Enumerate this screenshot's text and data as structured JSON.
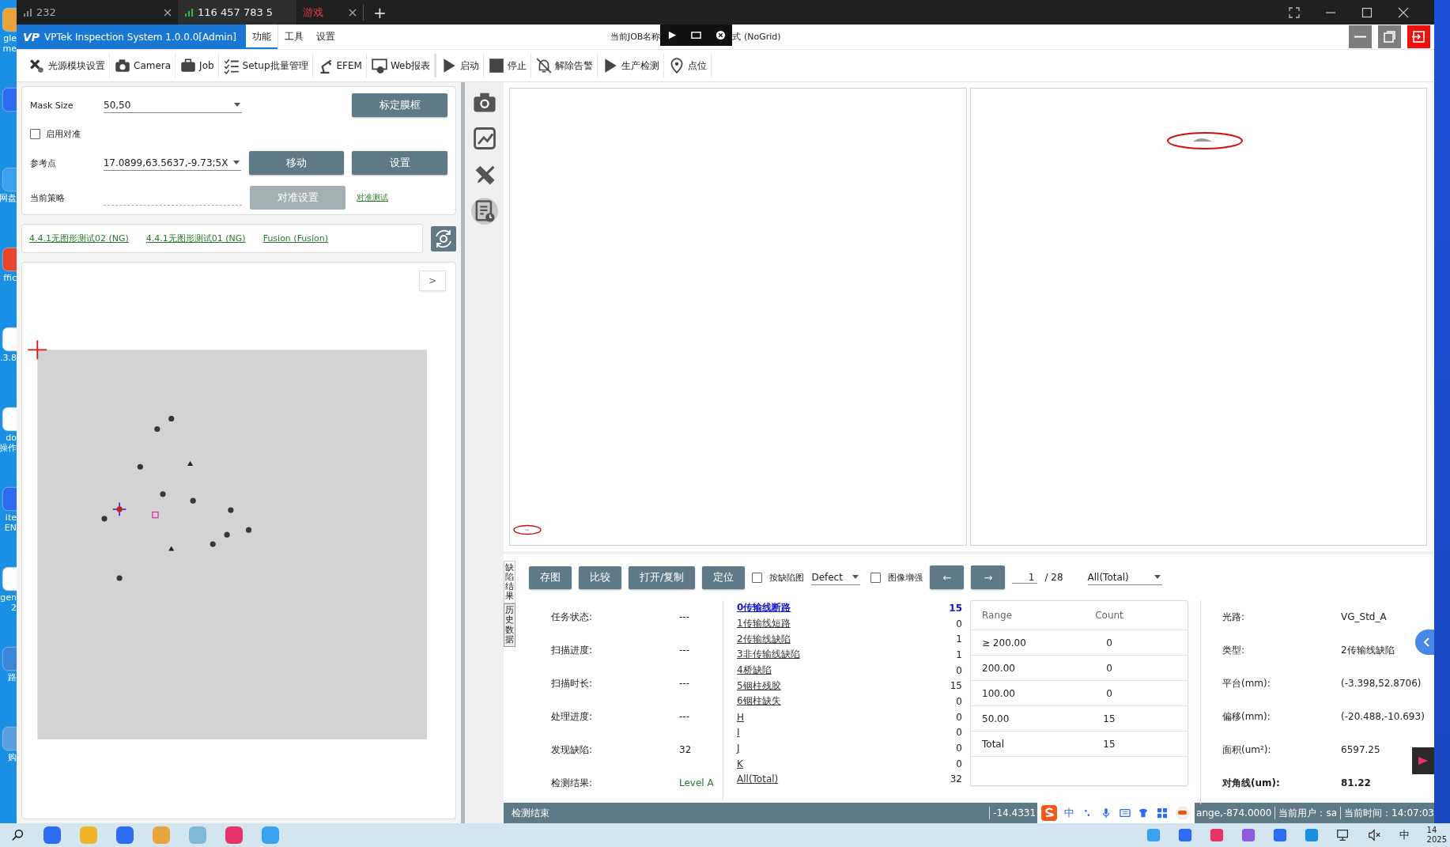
{
  "desktop": {
    "items": [
      {
        "kind": "labeled",
        "lines": [
          "gle",
          "me"
        ]
      },
      {
        "kind": "icon"
      },
      {
        "kind": "labeled",
        "lines": [
          "网盘"
        ]
      },
      {
        "kind": "labeled",
        "lines": [
          "ffic"
        ]
      },
      {
        "kind": "labeled",
        "lines": [
          ".3.8"
        ]
      },
      {
        "kind": "labeled",
        "lines": [
          "do",
          "操作"
        ]
      },
      {
        "kind": "labeled",
        "lines": [
          "ite",
          "EN"
        ]
      },
      {
        "kind": "labeled",
        "lines": [
          "gen",
          "2"
        ]
      },
      {
        "kind": "labeled",
        "lines": [
          "路"
        ]
      },
      {
        "kind": "labeled",
        "lines": [
          "购"
        ]
      }
    ]
  },
  "browser": {
    "tabs": [
      {
        "label": "232",
        "kind": "signal",
        "selected": false
      },
      {
        "label": "116 457 783 5",
        "kind": "signal",
        "selected": true
      },
      {
        "label": "游戏",
        "kind": "game",
        "selected": false
      }
    ],
    "new_tab": "+"
  },
  "app": {
    "logo": "VP",
    "title": "VPTek Inspection System 1.0.0.0[Admin]",
    "menu": [
      {
        "label": "功能",
        "selected": true
      },
      {
        "label": "工具",
        "selected": false
      },
      {
        "label": "设置",
        "selected": false
      }
    ],
    "job_title_before": "当前JOB名称",
    "job_title_after": "式 (NoGrid)"
  },
  "toolbar": [
    "光源模块设置",
    "Camera",
    "Job",
    "Setup批量管理",
    "EFEM",
    "Web报表",
    "启动",
    "停止",
    "解除告警",
    "生产检测",
    "点位"
  ],
  "setup": {
    "mask_size": {
      "label": "Mask Size",
      "value": "50,50"
    },
    "calibrate_button": "标定膜框",
    "align": {
      "label": "启用对准",
      "checked": false
    },
    "reference": {
      "label": "参考点",
      "value": "17.0899,63.5637,-9.73;5X"
    },
    "move_button": "移动",
    "set_button": "设置",
    "strategy": {
      "label": "当前策略"
    },
    "align_settings": {
      "label": "对准设置",
      "disabled": true
    },
    "align_test_link": "对准测试"
  },
  "recipes": [
    "4.4.1无图形测试02 (NG)",
    "4.4.1无图形测试01 (NG)",
    "Fusion (Fusion)"
  ],
  "map": {
    "expand_button": ">"
  },
  "side_tools": [
    {
      "selected": false
    },
    {
      "selected": false
    },
    {
      "selected": false
    },
    {
      "selected": true
    }
  ],
  "results": {
    "vtabs": [
      {
        "label": "缺陷结果",
        "selected": true
      },
      {
        "label": "历史数据",
        "selected": false
      }
    ],
    "buttons": [
      "存图",
      "比较",
      "打开/复制",
      "定位"
    ],
    "by_defect": {
      "label": "按缺陷图",
      "checked": false
    },
    "defect_select": "Defect",
    "enhance": {
      "label": "图像增强",
      "checked": false
    },
    "prev": "←",
    "next": "→",
    "page": "1",
    "total_pages": "/ 28",
    "filter": "All(Total)",
    "status": [
      {
        "label": "任务状态:",
        "value": "---",
        "kind": "plain"
      },
      {
        "label": "扫描进度:",
        "value": "---",
        "kind": "plain"
      },
      {
        "label": "扫描时长:",
        "value": "---",
        "kind": "plain"
      },
      {
        "label": "处理进度:",
        "value": "---",
        "kind": "plain"
      },
      {
        "label": "发现缺陷:",
        "value": "32",
        "kind": "plain"
      },
      {
        "label": "检测结果:",
        "value": "Level A",
        "kind": "result"
      }
    ],
    "defects": [
      {
        "name": "0传输线断路",
        "count": "15",
        "selected": true
      },
      {
        "name": "1传输线短路",
        "count": "0",
        "selected": false
      },
      {
        "name": "2传输线缺陷",
        "count": "1",
        "selected": false
      },
      {
        "name": "3非传输线缺陷",
        "count": "1",
        "selected": false
      },
      {
        "name": "4桥缺陷",
        "count": "0",
        "selected": false
      },
      {
        "name": "5铟柱残胶",
        "count": "15",
        "selected": false
      },
      {
        "name": "6铟柱缺失",
        "count": "0",
        "selected": false
      },
      {
        "name": "H",
        "count": "0",
        "selected": false
      },
      {
        "name": "I",
        "count": "0",
        "selected": false
      },
      {
        "name": "J",
        "count": "0",
        "selected": false
      },
      {
        "name": "K",
        "count": "0",
        "selected": false
      },
      {
        "name": "All(Total)",
        "count": "32",
        "selected": false
      }
    ],
    "ranges": {
      "columns": [
        "Range",
        "Count"
      ],
      "rows": [
        [
          "≥ 200.00",
          "0"
        ],
        [
          "200.00",
          "0"
        ],
        [
          "100.00",
          "0"
        ],
        [
          "50.00",
          "15"
        ],
        [
          "Total",
          "15"
        ]
      ]
    },
    "details": [
      {
        "label": "光路:",
        "value": "VG_Std_A",
        "emphasis": false
      },
      {
        "label": "类型:",
        "value": "2传输线缺陷",
        "emphasis": false
      },
      {
        "label": "平台(mm):",
        "value": "(-3.398,52.8706)",
        "emphasis": false
      },
      {
        "label": "偏移(mm):",
        "value": "(-20.488,-10.693)",
        "emphasis": false
      },
      {
        "label": "面积(um²):",
        "value": "6597.25",
        "emphasis": false
      },
      {
        "label": "对角线(um):",
        "value": "81.22",
        "emphasis": true
      }
    ]
  },
  "status_bar": {
    "message": "检测结束",
    "coordinate_start": "-14.4331",
    "ime": "中",
    "coordinate_end": "ange,-874.0000",
    "user": "当前用户：sa",
    "time": "当前时间：14:07:03"
  },
  "taskbar": {
    "ime": "中",
    "clock_time": "14",
    "clock_date": "2025"
  }
}
